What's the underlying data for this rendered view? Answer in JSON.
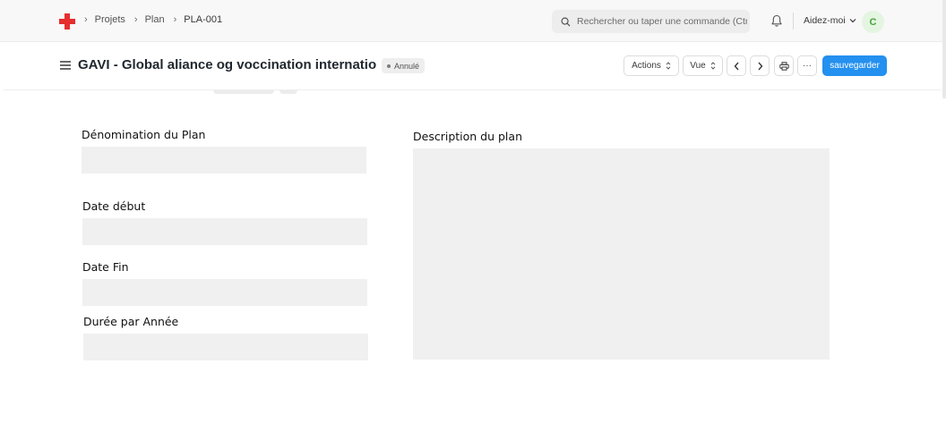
{
  "navbar": {
    "breadcrumbs": [
      "Projets",
      "Plan",
      "PLA-001"
    ],
    "search_placeholder": "Rechercher ou taper une commande (Ctrl + G)",
    "help_label": "Aidez-moi",
    "avatar_initial": "C"
  },
  "page_head": {
    "title": "GAVI - Global aliance og voccination internatio",
    "status_badge": "Annulé",
    "actions_label": "Actions",
    "view_label": "Vue",
    "more_label": "···",
    "save_label": "sauvegarder"
  },
  "form": {
    "plan_name": {
      "label": "Dénomination du Plan",
      "value": ""
    },
    "start_date": {
      "label": "Date début",
      "value": ""
    },
    "end_date": {
      "label": "Date Fin",
      "value": ""
    },
    "duration_per_year": {
      "label": "Durée par Année",
      "value": ""
    },
    "description": {
      "label": "Description du plan",
      "value": ""
    }
  },
  "colors": {
    "primary": "#2490ef",
    "logo_red": "#e62e2e",
    "avatar_bg": "#e4f5e1",
    "avatar_text": "#48a23a",
    "field_bg": "#f0f0f0"
  }
}
